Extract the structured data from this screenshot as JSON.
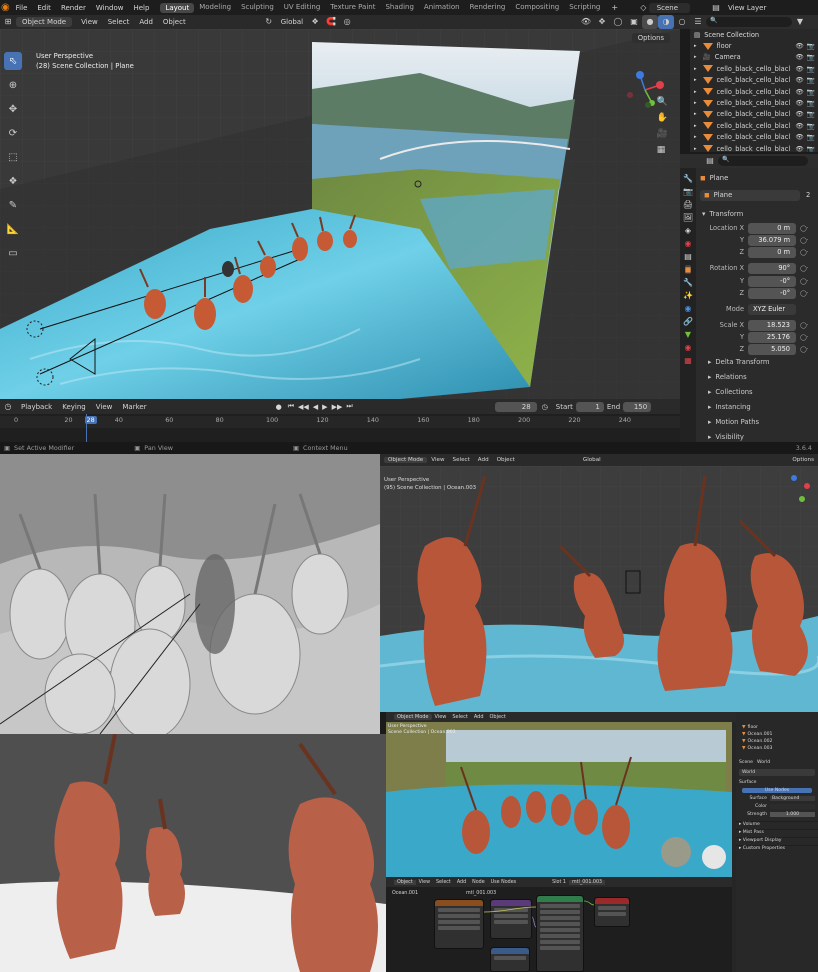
{
  "menu": [
    "File",
    "Edit",
    "Render",
    "Window",
    "Help"
  ],
  "workspaces": [
    "Layout",
    "Modeling",
    "Sculpting",
    "UV Editing",
    "Texture Paint",
    "Shading",
    "Animation",
    "Rendering",
    "Compositing",
    "Scripting"
  ],
  "active_workspace": "Layout",
  "scene_name": "Scene",
  "view_layer": "View Layer",
  "viewport_header": {
    "mode": "Object Mode",
    "items": [
      "View",
      "Select",
      "Add",
      "Object"
    ],
    "orientation": "Global",
    "options": "Options"
  },
  "viewport_overlay": {
    "line1": "User Perspective",
    "line2": "(28) Scene Collection | Plane"
  },
  "outliner": {
    "title": "Scene Collection",
    "rows": [
      "floor",
      "Camera",
      "cello_black_cello_blacl",
      "cello_black_cello_blacl",
      "cello_black_cello_blacl",
      "cello_black_cello_blacl",
      "cello_black_cello_blacl",
      "cello_black_cello_blacl",
      "cello_black_cello_blacl",
      "cello_black_cello_blacl"
    ]
  },
  "properties": {
    "object_name": "Plane",
    "data_name": "Plane",
    "users": "2",
    "transform_title": "Transform",
    "location_label": "Location X",
    "loc": [
      "0 m",
      "36.079 m",
      "0 m"
    ],
    "rotation_label": "Rotation X",
    "rot": [
      "90°",
      "-0°",
      "-0°"
    ],
    "mode_label": "Mode",
    "mode_value": "XYZ Euler",
    "scale_label": "Scale X",
    "scale": [
      "18.523",
      "25.176",
      "5.050"
    ],
    "axis_y": "Y",
    "axis_z": "Z",
    "panels": [
      "Delta Transform",
      "Relations",
      "Collections",
      "Instancing",
      "Motion Paths",
      "Visibility"
    ]
  },
  "timeline": {
    "menus": [
      "Playback",
      "Keying",
      "View",
      "Marker"
    ],
    "current_frame": "28",
    "start_label": "Start",
    "start": "1",
    "end_label": "End",
    "end": "150",
    "ticks": [
      "0",
      "20",
      "28",
      "40",
      "60",
      "80",
      "100",
      "120",
      "140",
      "160",
      "180",
      "200",
      "220",
      "240"
    ]
  },
  "status": {
    "left": "Set Active Modifier",
    "mid": "Pan View",
    "right": "Context Menu",
    "version": "3.6.4"
  },
  "panel3": {
    "mode": "Object Mode",
    "menus": [
      "View",
      "Select",
      "Add",
      "Object"
    ],
    "orientation": "Global",
    "line1": "User Perspective",
    "line2": "(95) Scene Collection | Ocean.003",
    "options": "Options"
  },
  "panel5": {
    "mode": "Object Mode",
    "menus": [
      "View",
      "Select",
      "Add",
      "Object"
    ],
    "line1": "User Perspective",
    "line2": "Scene Collection | Ocean.003",
    "node_header": {
      "mode": "Object",
      "menus": [
        "View",
        "Select",
        "Add",
        "Node"
      ],
      "use_nodes": "Use Nodes",
      "slot": "Slot 1",
      "material": "mtl_001.003",
      "object": "Ocean.001"
    },
    "outliner_rows": [
      "floor",
      "Ocean.001",
      "Ocean.002",
      "Ocean.003"
    ],
    "world_props": {
      "scene": "Scene",
      "world": "World",
      "world_name": "World",
      "surface": "Surface",
      "use_nodes": "Use Nodes",
      "surface_label": "Surface",
      "surface_val": "Background",
      "color_label": "Color",
      "strength_label": "Strength",
      "strength_val": "1.000",
      "panels": [
        "Volume",
        "Mist Pass",
        "Viewport Display",
        "Custom Properties"
      ]
    }
  }
}
